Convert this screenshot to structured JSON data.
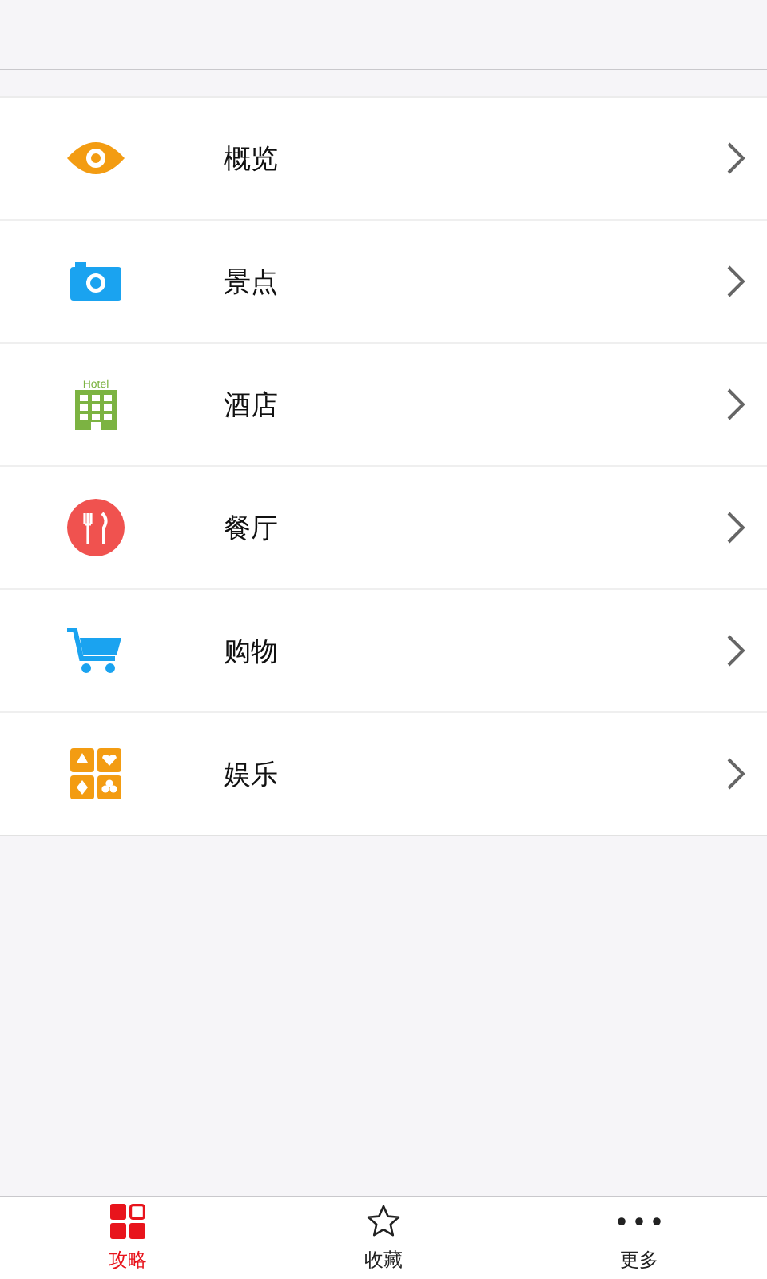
{
  "menu": [
    {
      "kind": "eye",
      "label": "概览"
    },
    {
      "kind": "camera",
      "label": "景点"
    },
    {
      "kind": "hotel",
      "label": "酒店",
      "icon_text": "Hotel"
    },
    {
      "kind": "dining",
      "label": "餐厅"
    },
    {
      "kind": "cart",
      "label": "购物"
    },
    {
      "kind": "cards",
      "label": "娱乐"
    }
  ],
  "tab_bar": [
    {
      "kind": "grid",
      "label": "攻略",
      "selected": true
    },
    {
      "kind": "star",
      "label": "收藏",
      "selected": false
    },
    {
      "kind": "dots",
      "label": "更多",
      "selected": false
    }
  ]
}
